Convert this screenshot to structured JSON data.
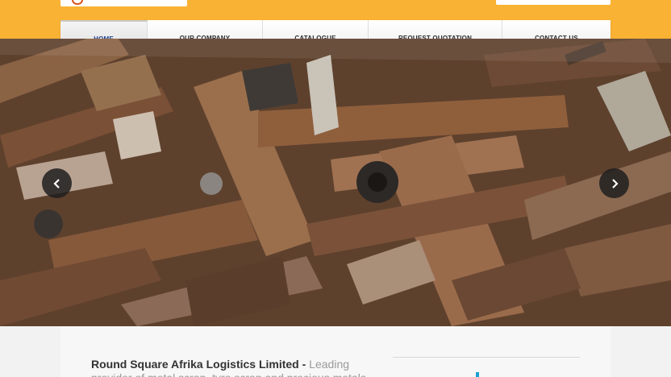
{
  "nav": {
    "items": [
      {
        "label": "HOME",
        "active": true
      },
      {
        "label": "OUR COMPANY",
        "active": false
      },
      {
        "label": "CATALOGUE",
        "active": false
      },
      {
        "label": "REQUEST QUOTATION",
        "active": false
      },
      {
        "label": "CONTACT US",
        "active": false
      }
    ]
  },
  "hero": {
    "image": "scrap-metal-pile",
    "prev_icon": "chevron-left-icon",
    "next_icon": "chevron-right-icon"
  },
  "intro": {
    "company": "Round Square Afrika Logistics Limited -",
    "tagline": " Leading provider of metal scrap, tyre scrap and precious metals"
  },
  "colors": {
    "topbar": "#f9b233",
    "nav_active_text": "#1d3f8f",
    "carousel_button": "#1e1e1e"
  }
}
